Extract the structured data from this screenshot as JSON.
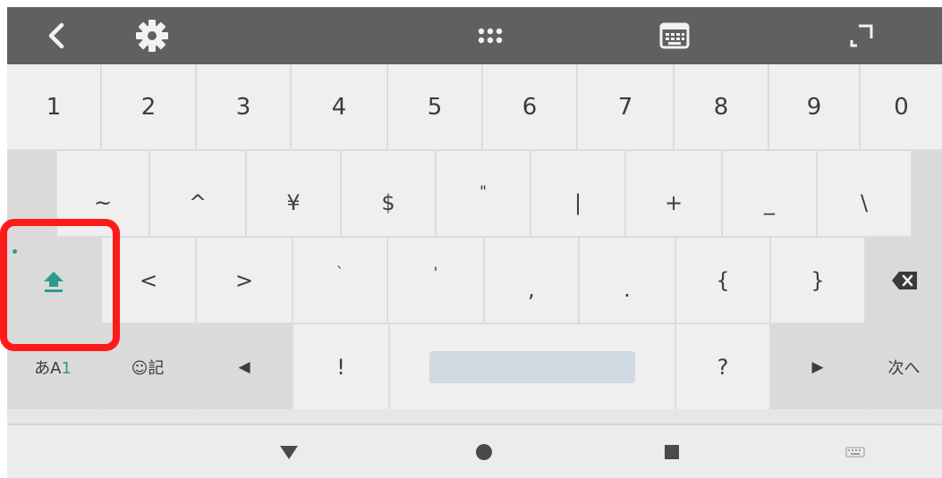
{
  "toolbar": {
    "back_icon": "chevron-left-icon",
    "settings_icon": "gear-icon",
    "menu_icon": "grid-dots-icon",
    "keyboard_icon": "keyboard-icon",
    "fullscreen_icon": "expand-icon"
  },
  "keyboard": {
    "row1": [
      "1",
      "2",
      "3",
      "4",
      "5",
      "6",
      "7",
      "8",
      "9",
      "0"
    ],
    "row2": [
      "~",
      "^",
      "¥",
      "$",
      "\"",
      "|",
      "+",
      "_",
      "\\"
    ],
    "row3": {
      "shift_icon": "shift-up-arrow-icon",
      "keys": [
        "<",
        ">",
        "`",
        "'",
        ",",
        ".",
        "{",
        "}"
      ],
      "backspace_icon": "backspace-icon"
    },
    "row4": {
      "mode_prefix": "あA",
      "mode_suffix": "1",
      "emoji_label": "☺記",
      "left_arrow": "◀",
      "exclaim": "!",
      "question": "?",
      "right_arrow": "▶",
      "next_label": "次へ"
    }
  },
  "nav": {
    "back_icon": "triangle-down-icon",
    "home_icon": "circle-icon",
    "recents_icon": "square-icon",
    "keyboard_switch_icon": "keyboard-small-icon"
  },
  "colors": {
    "accent": "#2e9c8a",
    "highlight": "#ff1a1a",
    "toolbar": "#5f6062"
  }
}
